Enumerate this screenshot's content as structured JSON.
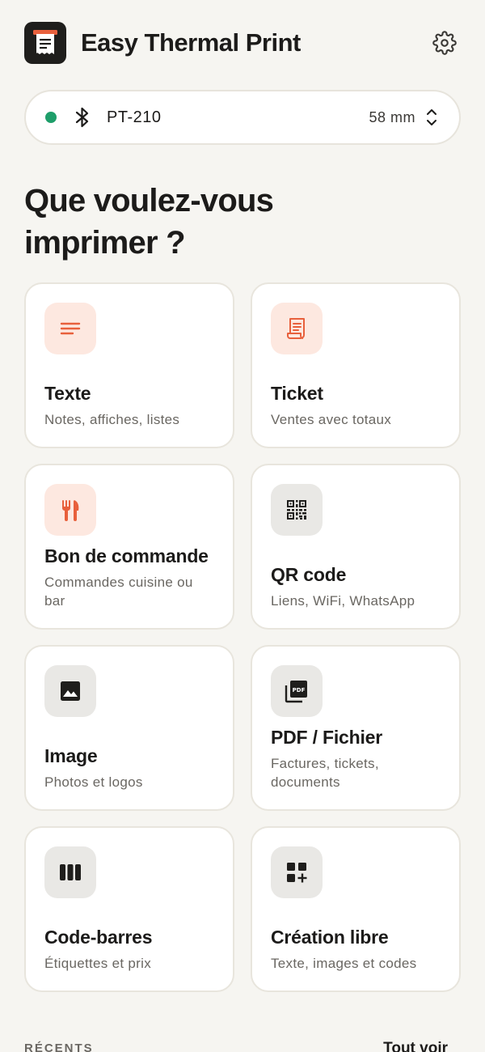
{
  "header": {
    "app_title": "Easy Thermal Print",
    "logo_icon": "receipt-printer-icon",
    "settings_icon": "gear-icon"
  },
  "printer": {
    "status_color": "#1e9e6a",
    "name": "PT-210",
    "paper_size": "58 mm"
  },
  "heading": "Que voulez-vous imprimer ?",
  "cards": [
    {
      "title": "Texte",
      "subtitle": "Notes, affiches, listes",
      "icon": "text-lines-icon",
      "tint": "warm"
    },
    {
      "title": "Ticket",
      "subtitle": "Ventes avec totaux",
      "icon": "receipt-icon",
      "tint": "warm"
    },
    {
      "title": "Bon de commande",
      "subtitle": "Commandes cuisine ou bar",
      "icon": "restaurant-icon",
      "tint": "warm"
    },
    {
      "title": "QR code",
      "subtitle": "Liens, WiFi, WhatsApp",
      "icon": "qr-code-icon",
      "tint": "gray"
    },
    {
      "title": "Image",
      "subtitle": "Photos et logos",
      "icon": "image-icon",
      "tint": "gray"
    },
    {
      "title": "PDF / Fichier",
      "subtitle": "Factures, tickets, documents",
      "icon": "pdf-icon",
      "tint": "gray"
    },
    {
      "title": "Code-barres",
      "subtitle": "Étiquettes et prix",
      "icon": "barcode-icon",
      "tint": "gray"
    },
    {
      "title": "Création libre",
      "subtitle": "Texte, images et codes",
      "icon": "grid-add-icon",
      "tint": "gray"
    }
  ],
  "recents": {
    "label": "RÉCENTS",
    "see_all": "Tout voir"
  },
  "colors": {
    "accent": "#e8603c",
    "background": "#f6f5f1",
    "icon_dark": "#1f1e1c"
  }
}
